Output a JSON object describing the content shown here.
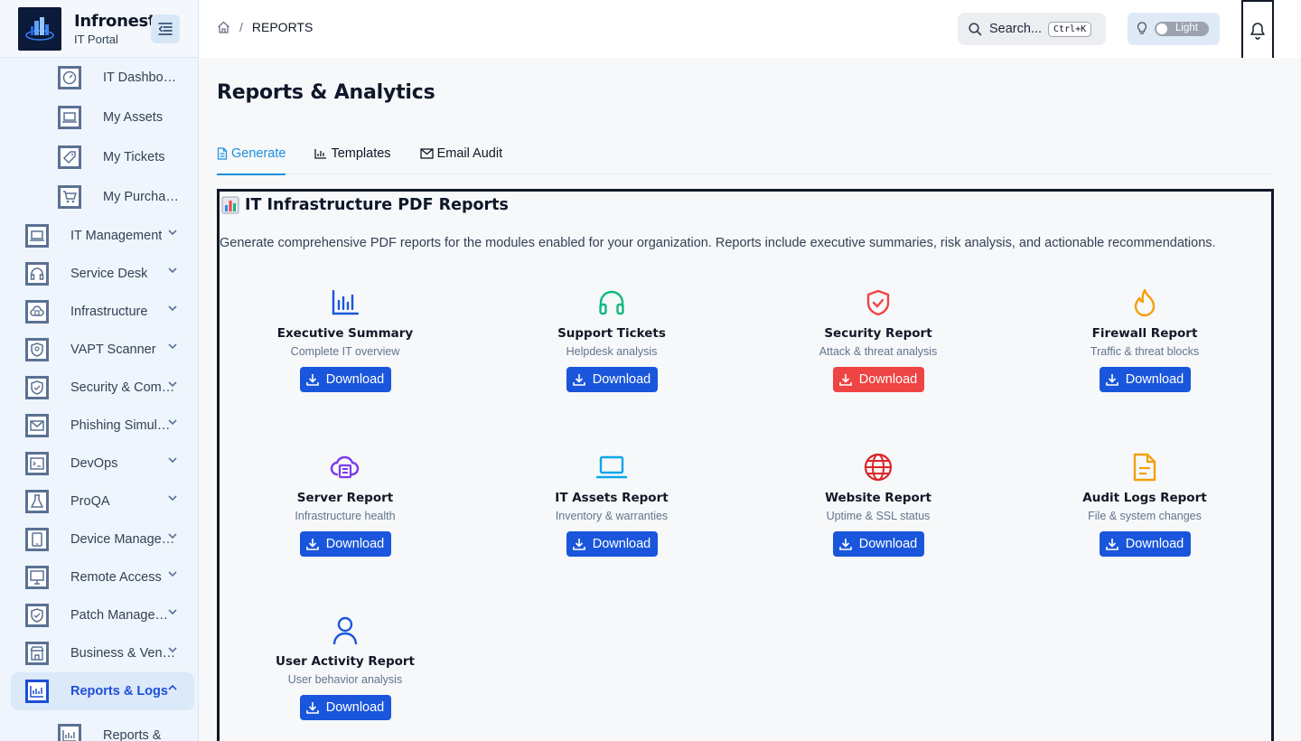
{
  "brand": {
    "name": "Infronest",
    "subtitle": "IT Portal"
  },
  "sidebar": {
    "sub_items_top": [
      {
        "label": "IT Dashboard",
        "icon": "gauge-icon"
      },
      {
        "label": "My Assets",
        "icon": "laptop-icon"
      },
      {
        "label": "My Tickets",
        "icon": "tag-icon"
      },
      {
        "label": "My Purchases",
        "icon": "cart-icon"
      }
    ],
    "items": [
      {
        "label": "IT Management",
        "icon": "laptop-icon"
      },
      {
        "label": "Service Desk",
        "icon": "headset-icon"
      },
      {
        "label": "Infrastructure",
        "icon": "cloud-server-icon"
      },
      {
        "label": "VAPT Scanner",
        "icon": "shield-search-icon"
      },
      {
        "label": "Security & Compliance",
        "icon": "shield-check-icon"
      },
      {
        "label": "Phishing Simulation",
        "icon": "mail-icon"
      },
      {
        "label": "DevOps",
        "icon": "terminal-icon"
      },
      {
        "label": "ProQA",
        "icon": "flask-icon"
      },
      {
        "label": "Device Management",
        "icon": "tablet-icon"
      },
      {
        "label": "Remote Access",
        "icon": "monitor-icon"
      },
      {
        "label": "Patch Management",
        "icon": "shield-check-icon"
      },
      {
        "label": "Business & Vendors",
        "icon": "store-icon"
      },
      {
        "label": "Reports & Logs",
        "icon": "bar-chart-icon",
        "active": true
      }
    ],
    "sub_items_bottom": [
      {
        "label": "Reports &",
        "icon": "bar-chart-icon"
      }
    ]
  },
  "topbar": {
    "breadcrumb_current": "REPORTS",
    "search_label": "Search...",
    "search_shortcut": "Ctrl+K",
    "theme_label": "Light"
  },
  "page": {
    "title": "Reports & Analytics",
    "tabs": [
      {
        "label": "Generate",
        "active": true
      },
      {
        "label": "Templates"
      },
      {
        "label": "Email Audit"
      }
    ]
  },
  "panel": {
    "title": "IT Infrastructure PDF Reports",
    "description": "Generate comprehensive PDF reports for the modules enabled for your organization. Reports include executive summaries, risk analysis, and actionable recommendations.",
    "download_label": "Download",
    "cards": [
      {
        "name": "Executive Summary",
        "desc": "Complete IT overview",
        "icon": "bar-chart-icon",
        "color": "#1a56db"
      },
      {
        "name": "Support Tickets",
        "desc": "Helpdesk analysis",
        "icon": "headset-icon",
        "color": "#10b981"
      },
      {
        "name": "Security Report",
        "desc": "Attack & threat analysis",
        "icon": "shield-check-icon",
        "color": "#ef4444",
        "button_color": "#ef4444"
      },
      {
        "name": "Firewall Report",
        "desc": "Traffic & threat blocks",
        "icon": "flame-icon",
        "color": "#f59e0b"
      },
      {
        "name": "Server Report",
        "desc": "Infrastructure health",
        "icon": "cloud-server-icon",
        "color": "#7c3aed"
      },
      {
        "name": "IT Assets Report",
        "desc": "Inventory & warranties",
        "icon": "laptop-icon",
        "color": "#0ea5e9"
      },
      {
        "name": "Website Report",
        "desc": "Uptime & SSL status",
        "icon": "globe-icon",
        "color": "#dc2626"
      },
      {
        "name": "Audit Logs Report",
        "desc": "File & system changes",
        "icon": "file-icon",
        "color": "#f59e0b"
      },
      {
        "name": "User Activity Report",
        "desc": "User behavior analysis",
        "icon": "user-icon",
        "color": "#1a56db"
      }
    ]
  }
}
